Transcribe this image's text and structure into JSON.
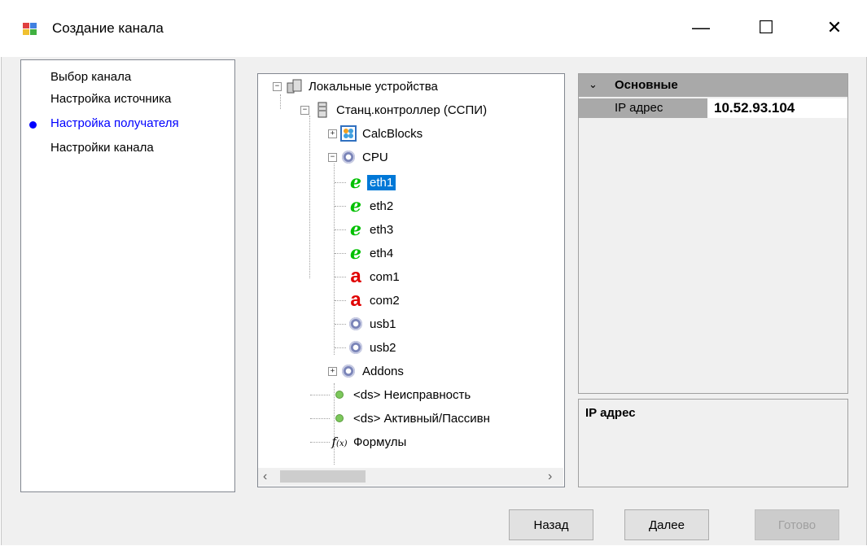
{
  "window": {
    "title": "Создание канала",
    "minimize": "—",
    "maximize": "☐",
    "close": "✕"
  },
  "steps": [
    {
      "label": "Выбор канала",
      "active": false
    },
    {
      "label": "Настройка источника",
      "active": false
    },
    {
      "label": "Настройка получателя",
      "active": true
    },
    {
      "label": "Настройки канала",
      "active": false
    }
  ],
  "tree": {
    "root": "Локальные устройства",
    "controller": "Станц.контроллер (ССПИ)",
    "calcblocks": "CalcBlocks",
    "cpu": "CPU",
    "eth1": "eth1",
    "eth2": "eth2",
    "eth3": "eth3",
    "eth4": "eth4",
    "com1": "com1",
    "com2": "com2",
    "usb1": "usb1",
    "usb2": "usb2",
    "addons": "Addons",
    "ds1": "<ds> Неисправность",
    "ds2": "<ds> Активный/Пассивн",
    "formulas": "Формулы",
    "selected": "eth1"
  },
  "properties": {
    "category": "Основные",
    "rows": [
      {
        "name": "IP адрес",
        "value": "10.52.93.104"
      }
    ],
    "description_title": "IP адрес"
  },
  "buttons": {
    "back": "Назад",
    "next": "Далее",
    "finish": "Готово"
  }
}
